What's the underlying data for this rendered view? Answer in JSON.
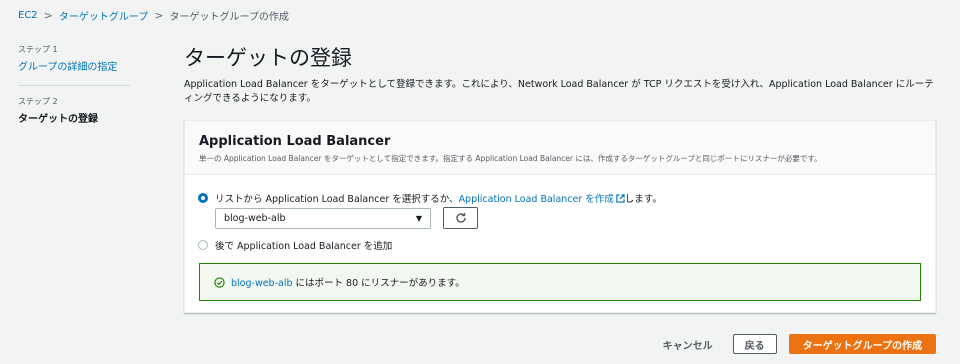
{
  "breadcrumb": {
    "items": [
      "EC2",
      "ターゲットグループ",
      "ターゲットグループの作成"
    ],
    "separator": ">"
  },
  "steps": [
    {
      "label": "ステップ 1",
      "name": "グループの詳細の指定"
    },
    {
      "label": "ステップ 2",
      "name": "ターゲットの登録"
    }
  ],
  "page_title": "ターゲットの登録",
  "description": "Application Load Balancer をターゲットとして登録できます。これにより、Network Load Balancer が TCP リクエストを受け入れ、Application Load Balancer にルーティングできるようになります。",
  "panel": {
    "title": "Application Load Balancer",
    "subtitle": "単一の Application Load Balancer をターゲットとして指定できます。指定する Application Load Balancer には、作成するターゲットグループと同じポートにリスナーが必要です。",
    "option1": {
      "text_before": "リストから Application Load Balancer を選択するか、",
      "link": "Application Load Balancer を作成",
      "text_after": "します。",
      "selected": true
    },
    "select_value": "blog-web-alb",
    "option2": {
      "text": "後で Application Load Balancer を追加",
      "selected": false
    },
    "success": {
      "alb_name": "blog-web-alb",
      "message": " にはポート 80 にリスナーがあります。"
    }
  },
  "footer": {
    "cancel": "キャンセル",
    "back": "戻る",
    "create": "ターゲットグループの作成"
  },
  "colors": {
    "link": "#0073bb",
    "primary_button": "#ec7211",
    "success_border": "#1d8102",
    "background": "#f2f3f3"
  },
  "icons": [
    "external-link-icon",
    "refresh-icon",
    "check-circle-icon",
    "caret-down-icon"
  ]
}
